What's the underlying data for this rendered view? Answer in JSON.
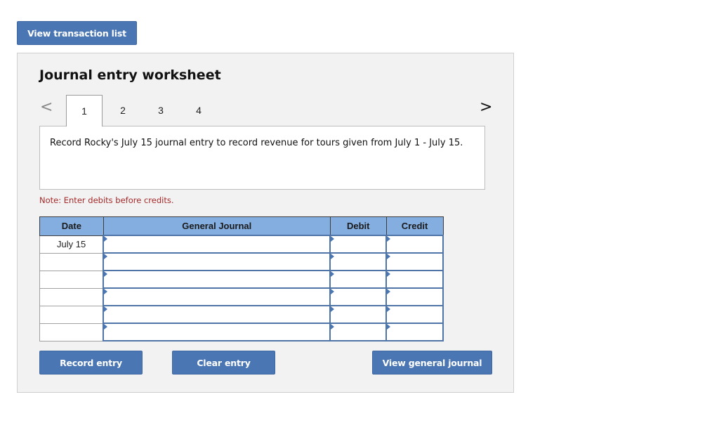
{
  "top_button": {
    "label": "View transaction list"
  },
  "worksheet": {
    "title": "Journal entry worksheet",
    "nav": {
      "prev_icon": "chevron-left-icon",
      "prev_glyph": "<",
      "next_icon": "chevron-right-icon",
      "next_glyph": ">"
    },
    "tabs": [
      {
        "label": "1",
        "active": true
      },
      {
        "label": "2",
        "active": false
      },
      {
        "label": "3",
        "active": false
      },
      {
        "label": "4",
        "active": false
      }
    ],
    "description": "Record Rocky's July 15 journal entry to record revenue for tours given from July 1 - July 15.",
    "note": "Note: Enter debits before credits.",
    "table": {
      "headers": {
        "date": "Date",
        "account": "General Journal",
        "debit": "Debit",
        "credit": "Credit"
      },
      "rows": [
        {
          "date": "July 15",
          "account": "",
          "debit": "",
          "credit": ""
        },
        {
          "date": "",
          "account": "",
          "debit": "",
          "credit": ""
        },
        {
          "date": "",
          "account": "",
          "debit": "",
          "credit": ""
        },
        {
          "date": "",
          "account": "",
          "debit": "",
          "credit": ""
        },
        {
          "date": "",
          "account": "",
          "debit": "",
          "credit": ""
        },
        {
          "date": "",
          "account": "",
          "debit": "",
          "credit": ""
        }
      ]
    },
    "buttons": {
      "record": "Record entry",
      "clear": "Clear entry",
      "view_journal": "View general journal"
    }
  },
  "colors": {
    "button": "#4a76b3",
    "header": "#84aee0",
    "note": "#a52a2a",
    "panel": "#f2f2f2"
  }
}
